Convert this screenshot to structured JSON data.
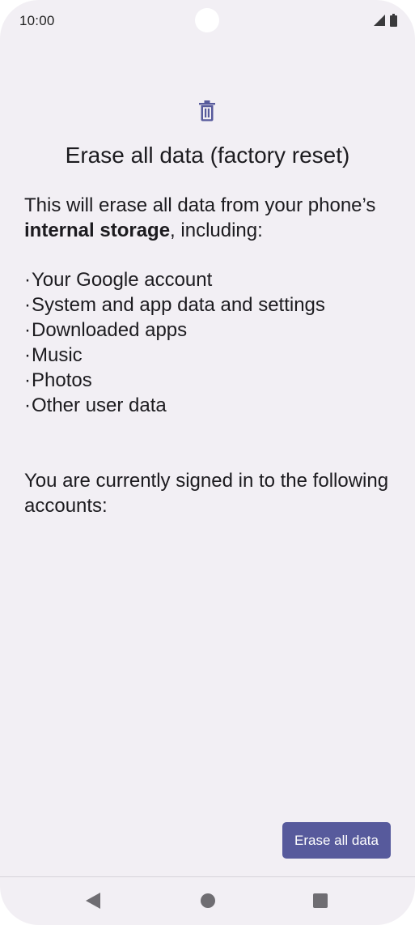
{
  "status_bar": {
    "time": "10:00",
    "icons": [
      "signal-icon",
      "battery-icon"
    ]
  },
  "page": {
    "icon": "trash-icon",
    "title": "Erase all data (factory reset)",
    "description_prefix": "This will erase all data from your phone’s ",
    "description_bold": "internal storage",
    "description_suffix": ", including:",
    "items": [
      "Your Google account",
      "System and app data and settings",
      "Downloaded apps",
      "Music",
      "Photos",
      "Other user data"
    ],
    "accounts_text": "You are currently signed in to the following accounts:"
  },
  "actions": {
    "erase_label": "Erase all data"
  },
  "nav": {
    "icons": [
      "back-icon",
      "home-icon",
      "recents-icon"
    ]
  },
  "colors": {
    "accent": "#575a9c",
    "background": "#f2eff4"
  }
}
